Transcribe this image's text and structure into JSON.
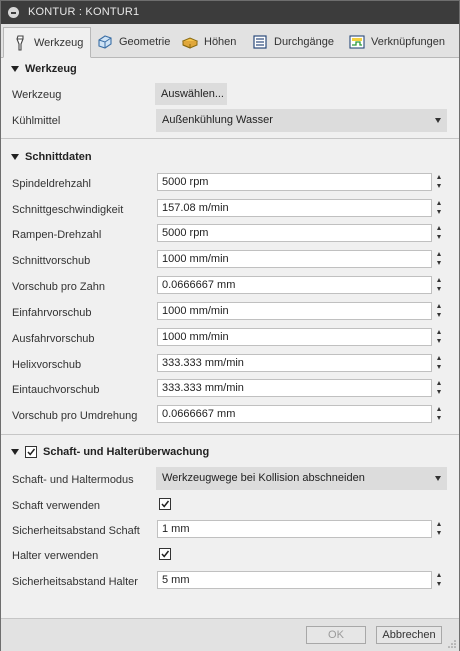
{
  "window": {
    "title": "KONTUR : KONTUR1"
  },
  "tabs": [
    {
      "label": "Werkzeug",
      "icon": "tool-icon"
    },
    {
      "label": "Geometrie",
      "icon": "geometry-icon"
    },
    {
      "label": "Höhen",
      "icon": "heights-icon"
    },
    {
      "label": "Durchgänge",
      "icon": "passes-icon"
    },
    {
      "label": "Verknüpfungen",
      "icon": "linking-icon"
    }
  ],
  "werkzeug": {
    "title": "Werkzeug",
    "tool_label": "Werkzeug",
    "tool_button": "Auswählen...",
    "coolant_label": "Kühlmittel",
    "coolant_value": "Außenkühlung Wasser"
  },
  "schnittdaten": {
    "title": "Schnittdaten",
    "rows": [
      {
        "label": "Spindeldrehzahl",
        "value": "5000 rpm"
      },
      {
        "label": "Schnittgeschwindigkeit",
        "value": "157.08 m/min"
      },
      {
        "label": "Rampen-Drehzahl",
        "value": "5000 rpm"
      },
      {
        "label": "Schnittvorschub",
        "value": "1000 mm/min"
      },
      {
        "label": "Vorschub pro Zahn",
        "value": "0.0666667 mm"
      },
      {
        "label": "Einfahrvorschub",
        "value": "1000 mm/min"
      },
      {
        "label": "Ausfahrvorschub",
        "value": "1000 mm/min"
      },
      {
        "label": "Helixvorschub",
        "value": "333.333 mm/min"
      },
      {
        "label": "Eintauchvorschub",
        "value": "333.333 mm/min"
      },
      {
        "label": "Vorschub pro Umdrehung",
        "value": "0.0666667 mm"
      }
    ]
  },
  "schaft": {
    "title": "Schaft- und Halterüberwachung",
    "enabled": true,
    "mode_label": "Schaft- und Haltermodus",
    "mode_value": "Werkzeugwege bei Kollision abschneiden",
    "use_shaft_label": "Schaft verwenden",
    "use_shaft_checked": true,
    "shaft_clearance_label": "Sicherheitsabstand Schaft",
    "shaft_clearance_value": "1 mm",
    "use_holder_label": "Halter verwenden",
    "use_holder_checked": true,
    "holder_clearance_label": "Sicherheitsabstand Halter",
    "holder_clearance_value": "5 mm"
  },
  "footer": {
    "ok_label": "OK",
    "cancel_label": "Abbrechen"
  }
}
